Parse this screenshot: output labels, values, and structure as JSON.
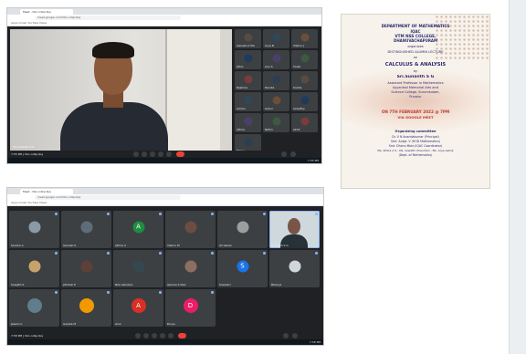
{
  "screenshot_top": {
    "tab_title": "Meet - hbn-ndzp-fpq",
    "url": "meet.google.com/hbn-ndzp-fpq",
    "bookmarks": "Apps   Gmail   YouTube   Maps",
    "main_participant": "Sri.Sunanth S.G",
    "meeting_info": "7:55 PM | hbn-ndzp-fpq",
    "taskbar_time": "7:55 PM",
    "grid": [
      "Ganesh K Ma",
      "Arya B",
      "Vishnu J",
      "Jithin",
      "Anu S",
      "Vivek",
      "Reshma",
      "Devika",
      "Sneha",
      "Ammu",
      "Gokul",
      "Aswathy",
      "Athira",
      "Nithin",
      "Akhil",
      "Manju"
    ]
  },
  "screenshot_bottom": {
    "tab_title": "Meet - hbn-ndzp-fpq",
    "url": "meet.google.com/hbn-ndzp-fpq",
    "bookmarks": "Apps   Gmail   YouTube   Maps",
    "meeting_info": "7:58 PM | hbn-ndzp-fpq",
    "taskbar_time": "7:58 PM",
    "tiles": [
      {
        "name": "Sandra A",
        "letter": "",
        "color": "#8a9aa6"
      },
      {
        "name": "Ganesh K",
        "letter": "",
        "color": "#5f6d7a"
      },
      {
        "name": "Athira A",
        "letter": "A",
        "color": "#1e8e3e"
      },
      {
        "name": "Vishnu M",
        "letter": "",
        "color": "#6d4c41"
      },
      {
        "name": "Ali Vaisal",
        "letter": "",
        "color": "#9e9e9e"
      },
      {
        "name": "Sunanth S G",
        "letter": "",
        "color": "#795548"
      },
      {
        "name": "Sreejith S",
        "letter": "",
        "color": "#c7a36b"
      },
      {
        "name": "Jithinlal P",
        "letter": "",
        "color": "#5d4037"
      },
      {
        "name": "Nila Ashokan",
        "letter": "",
        "color": "#37474f"
      },
      {
        "name": "Aparna S Nair",
        "letter": "",
        "color": "#8d6e63"
      },
      {
        "name": "Sreehari",
        "letter": "S",
        "color": "#1a73e8"
      },
      {
        "name": "Bhavya",
        "letter": "",
        "color": "#d0d7dc"
      },
      {
        "name": "Jeswin C",
        "letter": "",
        "color": "#607d8b"
      },
      {
        "name": "Gopika M",
        "letter": "",
        "color": "#f29900"
      },
      {
        "name": "Arun",
        "letter": "A",
        "color": "#d93025"
      },
      {
        "name": "Divya",
        "letter": "D",
        "color": "#e91e63"
      }
    ]
  },
  "poster": {
    "lines": [
      "DEPARTMENT OF MATHEMATICS",
      "IQAC",
      "VTM NSS COLLEGE,",
      "DHANUVACHAPURAM",
      "organizes",
      "DISTINGUISHED ALUMNI LECTURE",
      "on",
      "CALCULUS & ANALYSIS",
      "by",
      "Sri.Sunanth S G",
      "Assistant Professor in Mathematics",
      "Ayyankali Memorial Arts and",
      "Science College, Kurumkulam,",
      "Punalur",
      "ON 7TH FEBRUARY 2022 @ 7PM",
      "VIA GOOGLE MEET",
      "Organizing committee",
      "Dr. V N Anandakumar (Principal)",
      "Smt. Aneja. V (HOD Mathematics)",
      "Smt. Dhanu Mole (IQAC Coordinator)",
      "Ms. Athira A S - Ms. Aswathi Chandran - Ms. Arya Ashok",
      "(Dept. of Mathematics)"
    ]
  },
  "colors": {
    "meet_bg": "#202124",
    "tile_bg": "#3c4043",
    "end_call": "#ea4335",
    "poster_text": "#2b2a6e",
    "poster_accent": "#c0392b"
  }
}
